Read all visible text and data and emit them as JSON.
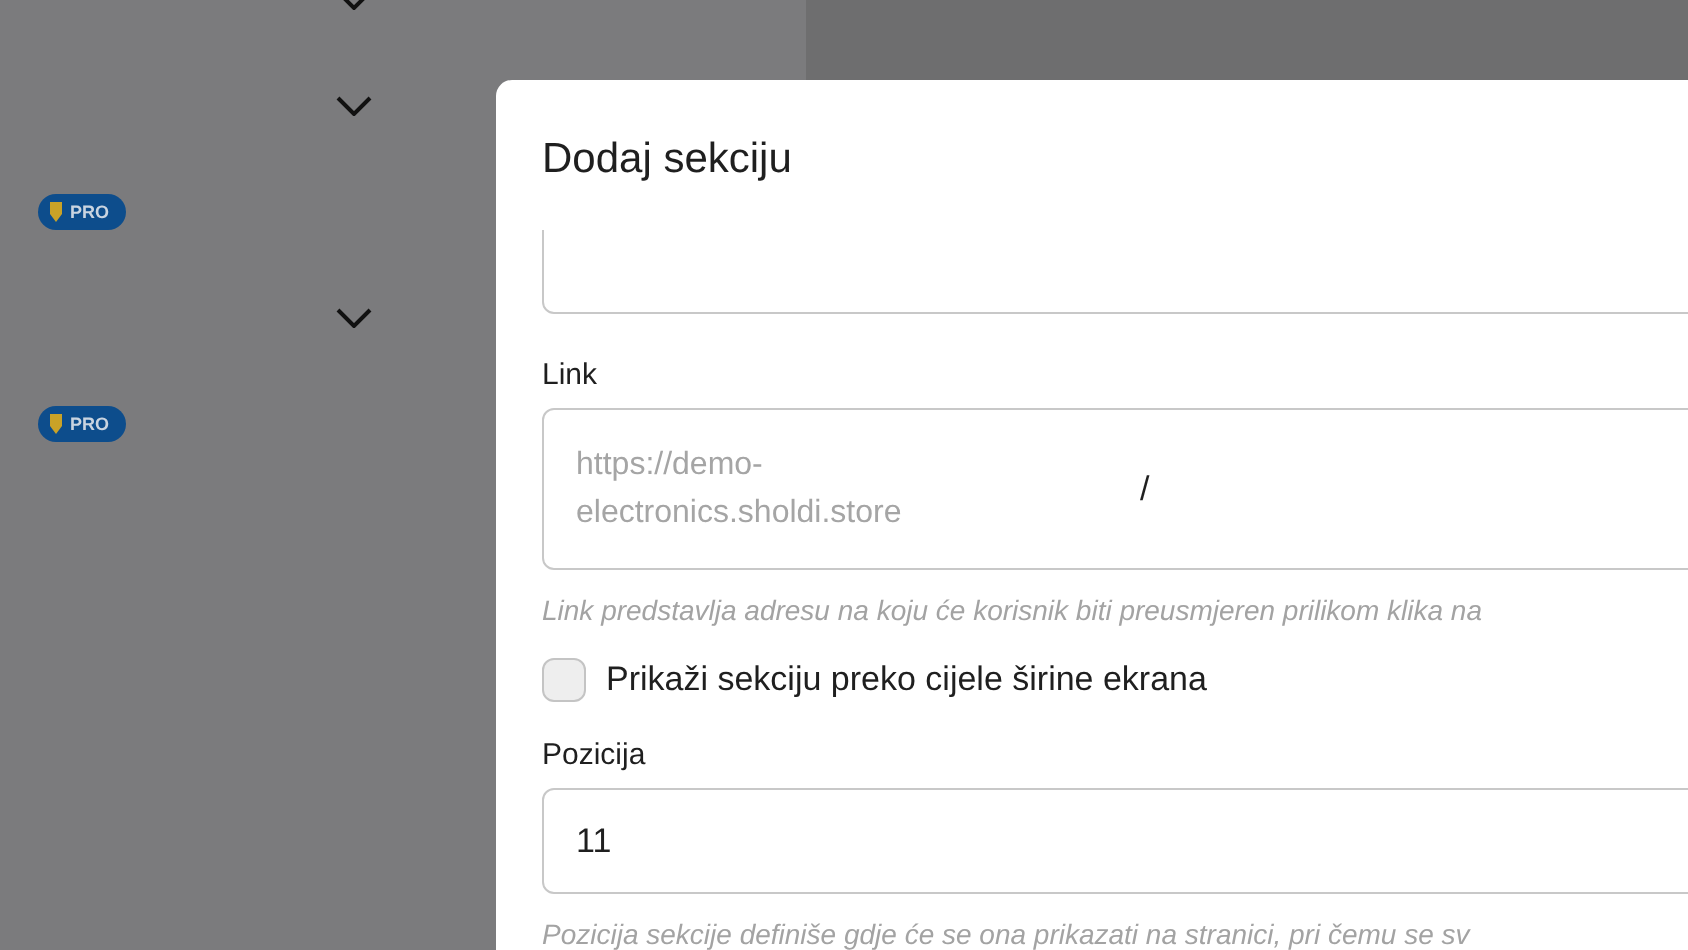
{
  "sidebar": {
    "items": [
      {
        "kind": "chevron"
      },
      {
        "kind": "chevron"
      },
      {
        "kind": "badge",
        "label": "PRO"
      },
      {
        "kind": "chevron"
      },
      {
        "kind": "badge",
        "label": "PRO"
      }
    ]
  },
  "dialog": {
    "title": "Dodaj sekciju",
    "fields": [
      {
        "kind": "text"
      },
      {
        "kind": "link",
        "label": "Link",
        "prefix": "https://demo-electronics.sholdi.store",
        "value": "/",
        "help": "Link predstavlja adresu na koju će korisnik biti preusmjeren prilikom klika na"
      },
      {
        "kind": "checkbox",
        "label": "Prikaži sekciju preko cijele širine ekrana",
        "checked": false
      },
      {
        "kind": "number",
        "label": "Pozicija",
        "value": "11",
        "help": "Pozicija sekcije definiše gdje će se ona prikazati na stranici, pri čemu se sv"
      }
    ]
  }
}
